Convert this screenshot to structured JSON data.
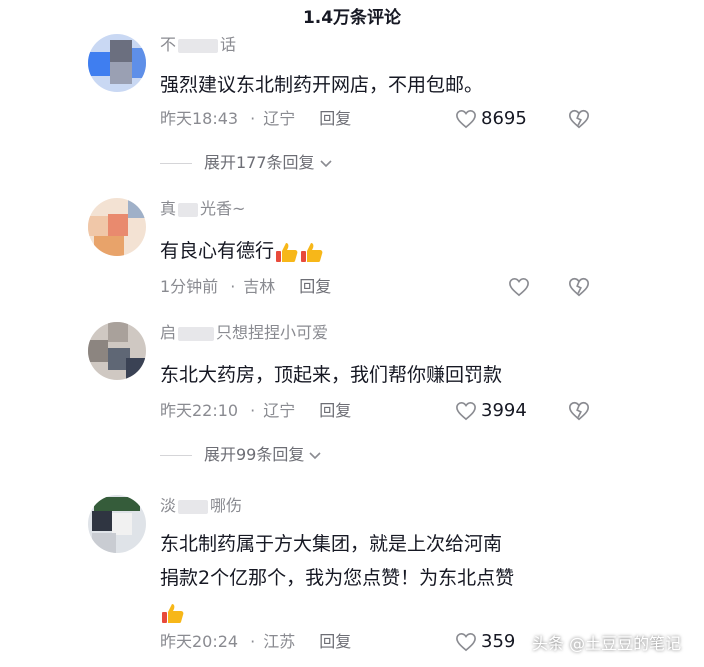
{
  "header": {
    "title": "1.4万条评论"
  },
  "comments": [
    {
      "username": "不",
      "username_tail": "话",
      "text": "强烈建议东北制药开网店，不用包邮。",
      "time": "昨天18:43",
      "location": "辽宁",
      "reply_label": "回复",
      "likes": "8695",
      "expand": "展开177条回复"
    },
    {
      "username": "真",
      "username_tail": "光香~",
      "text": "有良心有德行",
      "time": "1分钟前",
      "location": "吉林",
      "reply_label": "回复",
      "likes": ""
    },
    {
      "username": "启",
      "username_tail": "只想捏捏小可爱",
      "text": "东北大药房，顶起来，我们帮你赚回罚款",
      "time": "昨天22:10",
      "location": "辽宁",
      "reply_label": "回复",
      "likes": "3994",
      "expand": "展开99条回复"
    },
    {
      "username": "淡",
      "username_tail": "哪伤",
      "text_line1": "东北制药属于方大集团，就是上次给河南",
      "text_line2": "捐款2个亿那个，我为您点赞！为东北点赞",
      "time": "昨天20:24",
      "location": "江苏",
      "reply_label": "回复",
      "likes": "359"
    }
  ],
  "separator": "·",
  "watermark": "头条 @土豆豆的笔记",
  "colors": {
    "meta": "#8a8b91",
    "text": "#161823"
  }
}
